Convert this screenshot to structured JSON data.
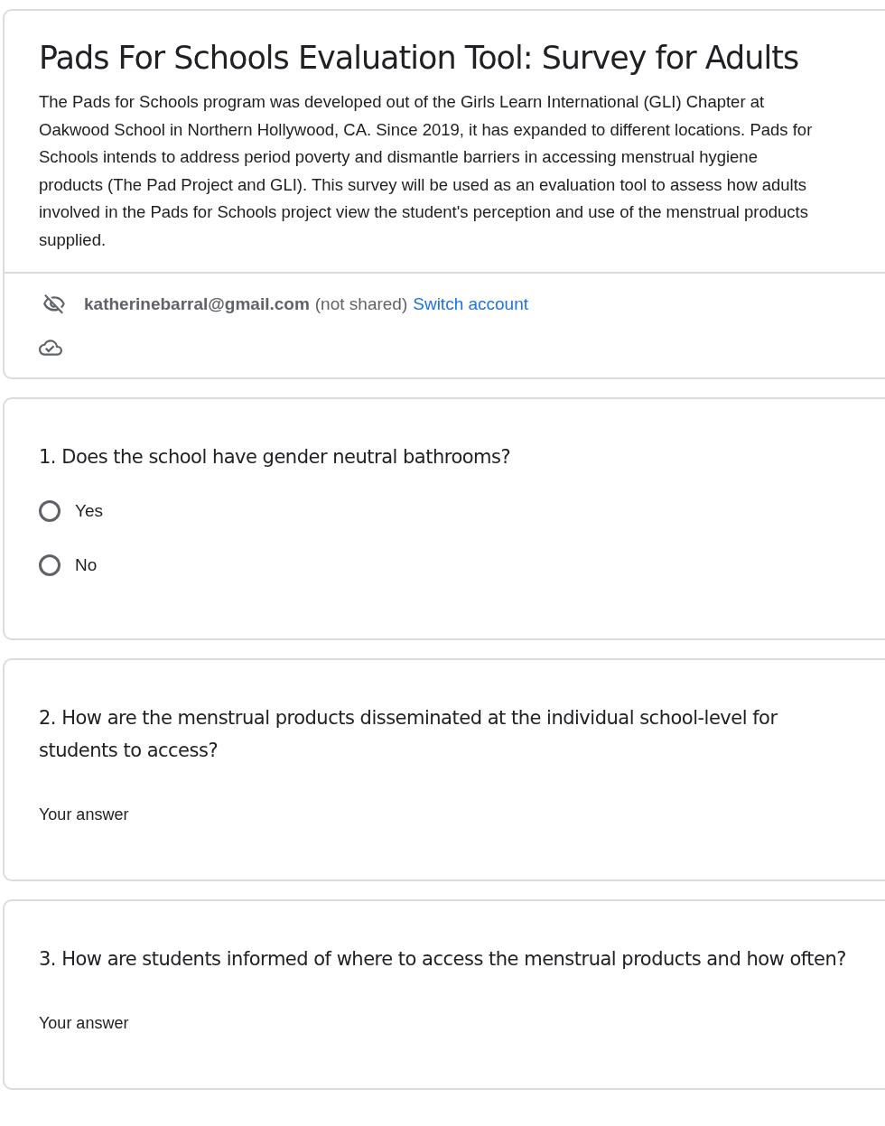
{
  "header": {
    "title": "Pads For Schools Evaluation Tool: Survey for Adults",
    "description": "The Pads for Schools program was developed out of the Girls Learn International (GLI) Chapter at Oakwood School in Northern Hollywood, CA. Since 2019, it has expanded to different locations. Pads for Schools intends to address period poverty and dismantle barriers in accessing menstrual hygiene products (The Pad Project and  GLI). This survey will be used as an evaluation tool to assess how adults involved in the Pads for Schools project view the student's perception and use of the menstrual products supplied.",
    "email": "katherinebarral@gmail.com",
    "not_shared": "(not shared)",
    "switch_account": "Switch account"
  },
  "questions": [
    {
      "kind": "radio",
      "title": "1. Does the school have gender neutral bathrooms?",
      "options": [
        {
          "label": "Yes",
          "selected": false
        },
        {
          "label": "No",
          "selected": false
        }
      ]
    },
    {
      "kind": "text",
      "title": "2. How are the menstrual products disseminated at the individual school-level for students to access?",
      "placeholder": "Your answer"
    },
    {
      "kind": "text",
      "title": "3. How are students informed of where to access the menstrual products and how often?",
      "placeholder": "Your answer"
    }
  ]
}
